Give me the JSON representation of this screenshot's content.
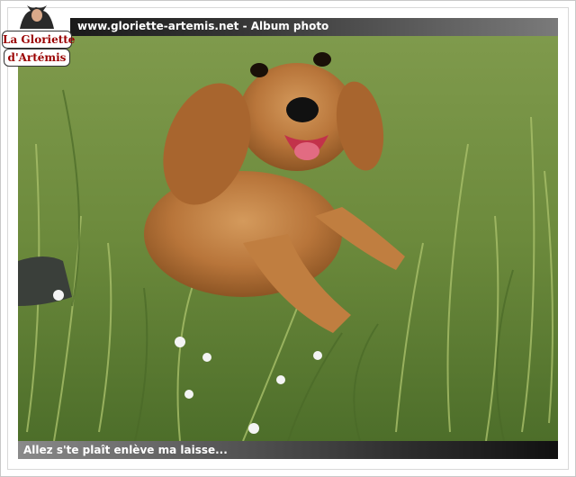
{
  "header": {
    "title": "www.gloriette-artemis.net - Album photo"
  },
  "logo": {
    "line1": "La Gloriette",
    "line2": "d'Artémis"
  },
  "photo": {
    "caption": "Allez s'te plaît enlève ma laisse..."
  },
  "colors": {
    "logo_text": "#9a0000",
    "grass": "#6f8a3f",
    "dog_fur": "#b8753a"
  }
}
